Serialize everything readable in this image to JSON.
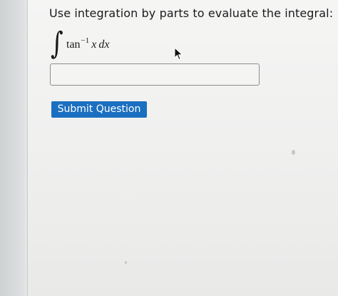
{
  "question": {
    "text": "Use integration by parts to evaluate the integral:"
  },
  "integral": {
    "sign": "∫",
    "function": "tan",
    "exponent": "−1",
    "variable": "x",
    "differential": "dx"
  },
  "answer": {
    "value": "",
    "placeholder": ""
  },
  "submit": {
    "label": "Submit Question",
    "color": "#1b6fc0"
  },
  "icons": {
    "pointer": "mouse-pointer-icon"
  }
}
